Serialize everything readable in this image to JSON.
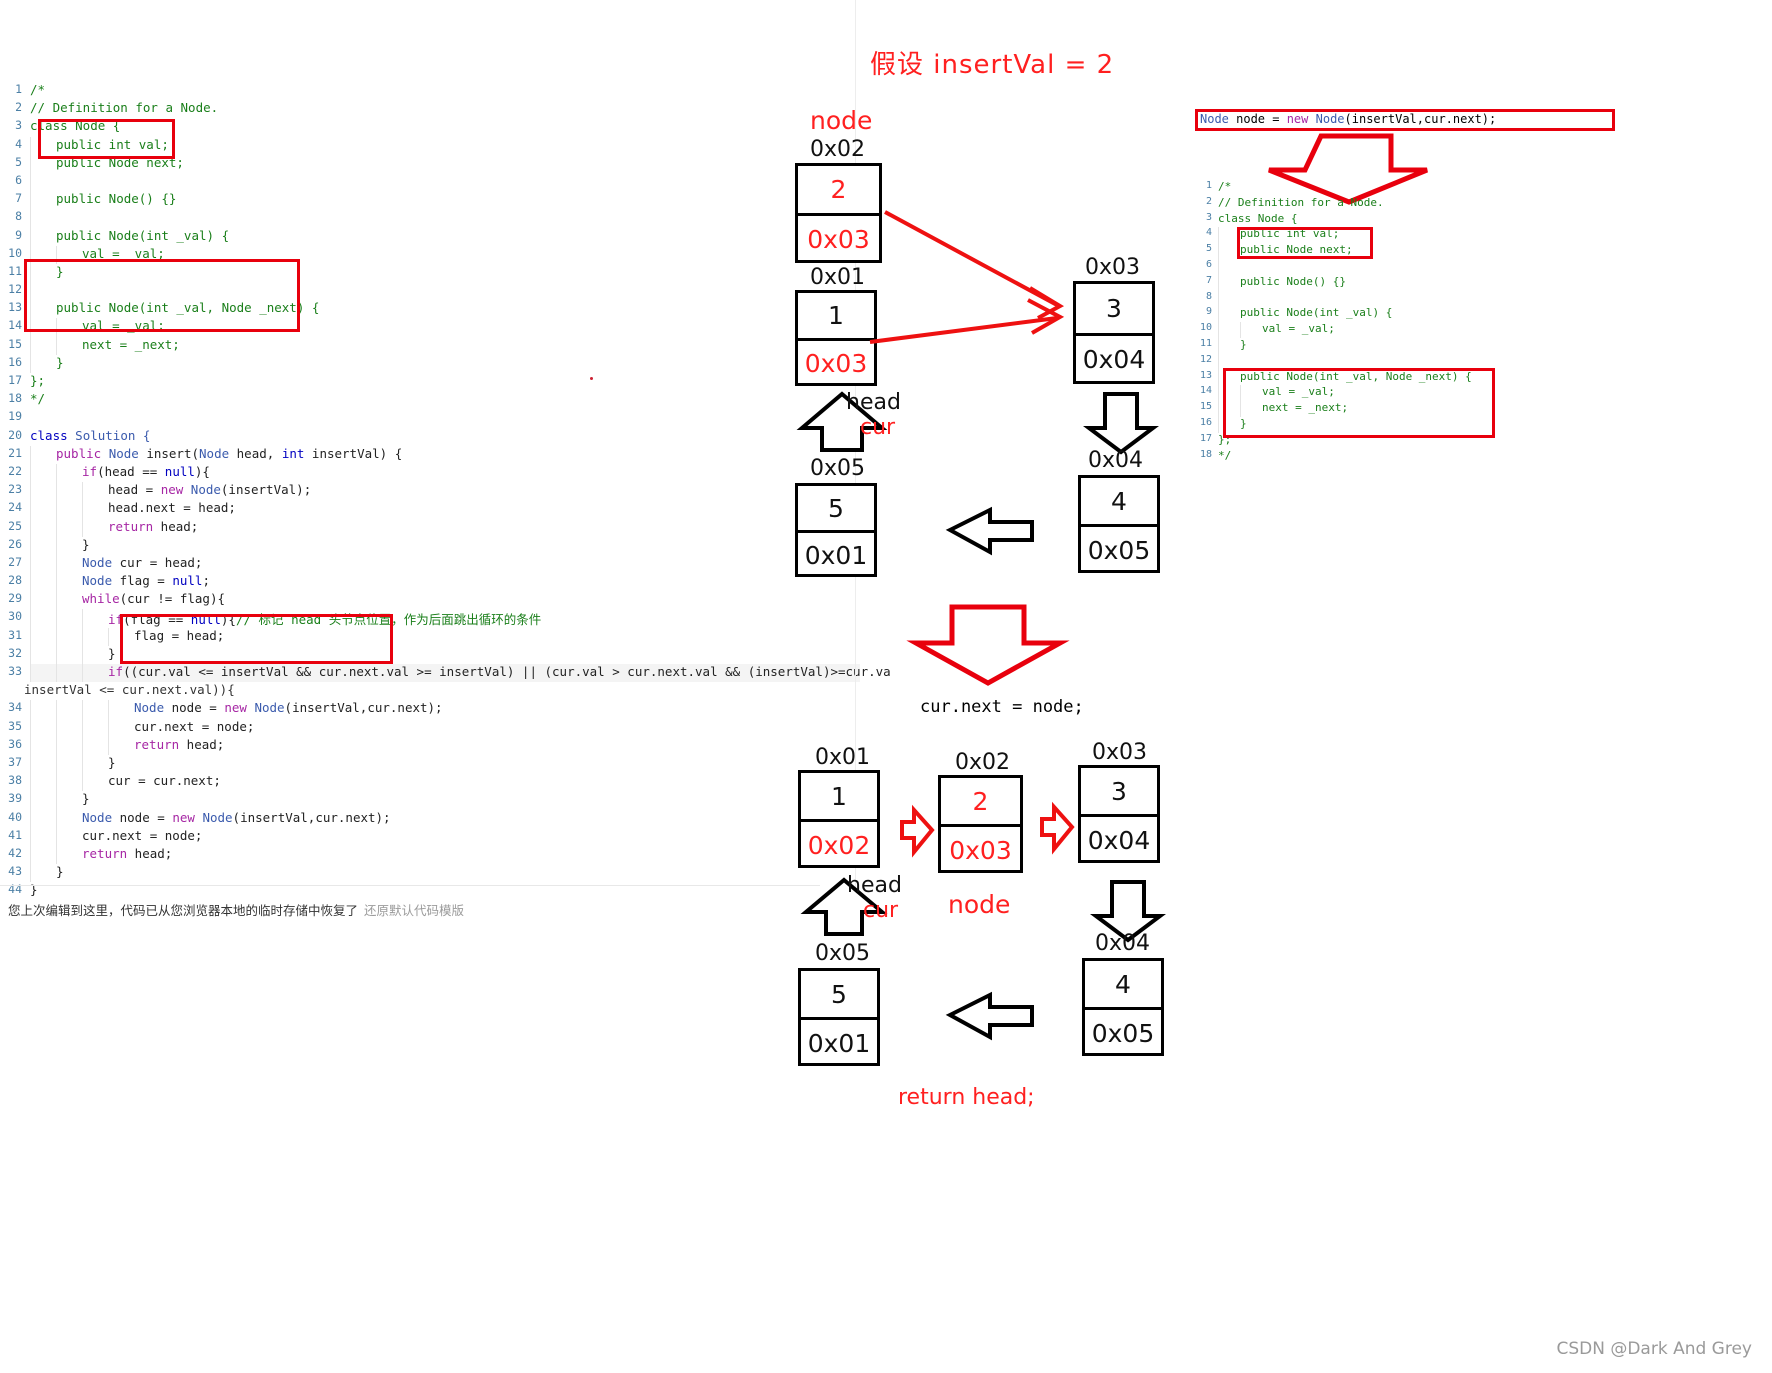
{
  "editor": {
    "lines": [
      {
        "n": "1",
        "indent": 0,
        "tokens": [
          {
            "t": "/*",
            "c": "cmt"
          }
        ]
      },
      {
        "n": "2",
        "indent": 0,
        "tokens": [
          {
            "t": "// Definition for a Node.",
            "c": "cmt"
          }
        ]
      },
      {
        "n": "3",
        "indent": 0,
        "tokens": [
          {
            "t": "class Node {",
            "c": "cmt"
          }
        ]
      },
      {
        "n": "4",
        "indent": 1,
        "tokens": [
          {
            "t": "public int val;",
            "c": "cmt"
          }
        ]
      },
      {
        "n": "5",
        "indent": 1,
        "tokens": [
          {
            "t": "public Node next;",
            "c": "cmt"
          }
        ]
      },
      {
        "n": "6",
        "indent": 1,
        "tokens": [
          {
            "t": "",
            "c": "cmt"
          }
        ]
      },
      {
        "n": "7",
        "indent": 1,
        "tokens": [
          {
            "t": "public Node() {}",
            "c": "cmt"
          }
        ]
      },
      {
        "n": "8",
        "indent": 1,
        "tokens": [
          {
            "t": "",
            "c": "cmt"
          }
        ]
      },
      {
        "n": "9",
        "indent": 1,
        "tokens": [
          {
            "t": "public Node(int _val) {",
            "c": "cmt"
          }
        ]
      },
      {
        "n": "10",
        "indent": 2,
        "tokens": [
          {
            "t": "val = _val;",
            "c": "cmt"
          }
        ]
      },
      {
        "n": "11",
        "indent": 1,
        "tokens": [
          {
            "t": "}",
            "c": "cmt"
          }
        ]
      },
      {
        "n": "12",
        "indent": 1,
        "tokens": [
          {
            "t": "",
            "c": "cmt"
          }
        ]
      },
      {
        "n": "13",
        "indent": 1,
        "tokens": [
          {
            "t": "public Node(int _val, Node _next) {",
            "c": "cmt"
          }
        ]
      },
      {
        "n": "14",
        "indent": 2,
        "tokens": [
          {
            "t": "val = _val;",
            "c": "cmt"
          }
        ]
      },
      {
        "n": "15",
        "indent": 2,
        "tokens": [
          {
            "t": "next = _next;",
            "c": "cmt"
          }
        ]
      },
      {
        "n": "16",
        "indent": 1,
        "tokens": [
          {
            "t": "}",
            "c": "cmt"
          }
        ]
      },
      {
        "n": "17",
        "indent": 0,
        "tokens": [
          {
            "t": "};",
            "c": "cmt"
          }
        ]
      },
      {
        "n": "18",
        "indent": 0,
        "tokens": [
          {
            "t": "*/",
            "c": "cmt"
          }
        ]
      },
      {
        "n": "19",
        "indent": 0,
        "tokens": [
          {
            "t": "",
            "c": "plain"
          }
        ]
      },
      {
        "n": "20",
        "indent": 0,
        "tokens": [
          {
            "t": "class",
            "c": "kw2"
          },
          {
            "t": " Solution {",
            "c": "typ"
          }
        ]
      },
      {
        "n": "21",
        "indent": 1,
        "tokens": [
          {
            "t": "public",
            "c": "kw"
          },
          {
            "t": " ",
            "c": "plain"
          },
          {
            "t": "Node",
            "c": "typ"
          },
          {
            "t": " insert(",
            "c": "plain"
          },
          {
            "t": "Node",
            "c": "typ"
          },
          {
            "t": " head, ",
            "c": "plain"
          },
          {
            "t": "int",
            "c": "kw2"
          },
          {
            "t": " insertVal) {",
            "c": "plain"
          }
        ]
      },
      {
        "n": "22",
        "indent": 2,
        "tokens": [
          {
            "t": "if",
            "c": "kw"
          },
          {
            "t": "(head == ",
            "c": "plain"
          },
          {
            "t": "null",
            "c": "kw2"
          },
          {
            "t": "){",
            "c": "plain"
          }
        ]
      },
      {
        "n": "23",
        "indent": 3,
        "tokens": [
          {
            "t": "head = ",
            "c": "plain"
          },
          {
            "t": "new",
            "c": "kw"
          },
          {
            "t": " ",
            "c": "plain"
          },
          {
            "t": "Node",
            "c": "typ"
          },
          {
            "t": "(insertVal);",
            "c": "plain"
          }
        ]
      },
      {
        "n": "24",
        "indent": 3,
        "tokens": [
          {
            "t": "head.next = head;",
            "c": "plain"
          }
        ]
      },
      {
        "n": "25",
        "indent": 3,
        "tokens": [
          {
            "t": "return",
            "c": "kw"
          },
          {
            "t": " head;",
            "c": "plain"
          }
        ]
      },
      {
        "n": "26",
        "indent": 2,
        "tokens": [
          {
            "t": "}",
            "c": "plain"
          }
        ]
      },
      {
        "n": "27",
        "indent": 2,
        "tokens": [
          {
            "t": "Node",
            "c": "typ"
          },
          {
            "t": " cur = head;",
            "c": "plain"
          }
        ]
      },
      {
        "n": "28",
        "indent": 2,
        "tokens": [
          {
            "t": "Node",
            "c": "typ"
          },
          {
            "t": " flag = ",
            "c": "plain"
          },
          {
            "t": "null",
            "c": "kw2"
          },
          {
            "t": ";",
            "c": "plain"
          }
        ]
      },
      {
        "n": "29",
        "indent": 2,
        "tokens": [
          {
            "t": "while",
            "c": "kw"
          },
          {
            "t": "(cur != flag){",
            "c": "plain"
          }
        ]
      },
      {
        "n": "30",
        "indent": 3,
        "tokens": [
          {
            "t": "if",
            "c": "kw"
          },
          {
            "t": "(flag == ",
            "c": "plain"
          },
          {
            "t": "null",
            "c": "kw2"
          },
          {
            "t": "){",
            "c": "plain"
          },
          {
            "t": "// 标记 head 头节点位置，作为后面跳出循环的条件",
            "c": "cmt"
          }
        ]
      },
      {
        "n": "31",
        "indent": 4,
        "tokens": [
          {
            "t": "flag = head;",
            "c": "plain"
          }
        ]
      },
      {
        "n": "32",
        "indent": 3,
        "tokens": [
          {
            "t": "}",
            "c": "plain"
          }
        ]
      },
      {
        "n": "33",
        "indent": 3,
        "hl": true,
        "tokens": [
          {
            "t": "if",
            "c": "kw"
          },
          {
            "t": "((cur.val <= insertVal && cur.next.val >= insertVal) || ",
            "c": "plain"
          },
          {
            "t": "(",
            "c": "plain"
          },
          {
            "t": "cur.val > cur.next.val && (insertVal)>=cur.va",
            "c": "plain"
          }
        ]
      },
      {
        "n": "34",
        "indent": 4,
        "tokens": [
          {
            "t": "Node",
            "c": "typ"
          },
          {
            "t": " node = ",
            "c": "plain"
          },
          {
            "t": "new",
            "c": "kw"
          },
          {
            "t": " ",
            "c": "plain"
          },
          {
            "t": "Node",
            "c": "typ"
          },
          {
            "t": "(insertVal,cur.next);",
            "c": "plain"
          }
        ]
      },
      {
        "n": "35",
        "indent": 4,
        "tokens": [
          {
            "t": "cur.next = node;",
            "c": "plain"
          }
        ]
      },
      {
        "n": "36",
        "indent": 4,
        "tokens": [
          {
            "t": "return",
            "c": "kw"
          },
          {
            "t": " head;",
            "c": "plain"
          }
        ]
      },
      {
        "n": "37",
        "indent": 3,
        "tokens": [
          {
            "t": "}",
            "c": "plain"
          }
        ]
      },
      {
        "n": "38",
        "indent": 3,
        "tokens": [
          {
            "t": "cur = cur.next;",
            "c": "plain"
          }
        ]
      },
      {
        "n": "39",
        "indent": 2,
        "tokens": [
          {
            "t": "}",
            "c": "plain"
          }
        ]
      },
      {
        "n": "40",
        "indent": 2,
        "tokens": [
          {
            "t": "Node",
            "c": "typ"
          },
          {
            "t": " node = ",
            "c": "plain"
          },
          {
            "t": "new",
            "c": "kw"
          },
          {
            "t": " ",
            "c": "plain"
          },
          {
            "t": "Node",
            "c": "typ"
          },
          {
            "t": "(insertVal,cur.next);",
            "c": "plain"
          }
        ]
      },
      {
        "n": "41",
        "indent": 2,
        "tokens": [
          {
            "t": "cur.next = node;",
            "c": "plain"
          }
        ]
      },
      {
        "n": "42",
        "indent": 2,
        "tokens": [
          {
            "t": "return",
            "c": "kw"
          },
          {
            "t": " head;",
            "c": "plain"
          }
        ]
      },
      {
        "n": "43",
        "indent": 1,
        "tokens": [
          {
            "t": "}",
            "c": "plain"
          }
        ]
      },
      {
        "n": "44",
        "indent": 0,
        "tokens": [
          {
            "t": "}",
            "c": "plain"
          }
        ]
      }
    ],
    "wrap_line_33": "insertVal <= cur.next.val)){",
    "footer": {
      "message": "您上次编辑到这里，代码已从您浏览器本地的临时存储中恢复了",
      "restore_link": "还原默认代码模版"
    }
  },
  "diagram": {
    "title": "假设  insertVal = 2",
    "stage1": {
      "node_tag": "node",
      "node_addr": "0x02",
      "node_val": "2",
      "node_next": "0x03",
      "n1_addr": "0x01",
      "n1_val": "1",
      "n1_next": "0x03",
      "n3_addr": "0x03",
      "n3_val": "3",
      "n3_next": "0x04",
      "head_label": "head",
      "cur_label": "cur",
      "n5_addr": "0x05",
      "n5_val": "5",
      "n5_next": "0x01",
      "n4_addr": "0x04",
      "n4_val": "4",
      "n4_next": "0x05"
    },
    "transition_code": "cur.next = node;",
    "stage2": {
      "n1_addr": "0x01",
      "n1_val": "1",
      "n1_next": "0x02",
      "n2_addr": "0x02",
      "n2_val": "2",
      "n2_next": "0x03",
      "n3_addr": "0x03",
      "n3_val": "3",
      "n3_next": "0x04",
      "head_label": "head",
      "cur_label": "cur",
      "node_label": "node",
      "n5_addr": "0x05",
      "n5_val": "5",
      "n5_next": "0x01",
      "n4_addr": "0x04",
      "n4_val": "4",
      "n4_next": "0x05",
      "return_label": "return head;"
    }
  },
  "rightcode": {
    "top_line": "Node node = new Node(insertVal,cur.next);",
    "lines": [
      {
        "n": "1",
        "indent": 0,
        "tokens": [
          {
            "t": "/*",
            "c": "cmt"
          }
        ]
      },
      {
        "n": "2",
        "indent": 0,
        "tokens": [
          {
            "t": "// Definition for a Node.",
            "c": "cmt"
          }
        ]
      },
      {
        "n": "3",
        "indent": 0,
        "tokens": [
          {
            "t": "class Node {",
            "c": "cmt"
          }
        ]
      },
      {
        "n": "4",
        "indent": 1,
        "tokens": [
          {
            "t": "public int val;",
            "c": "cmt"
          }
        ]
      },
      {
        "n": "5",
        "indent": 1,
        "tokens": [
          {
            "t": "public Node next;",
            "c": "cmt"
          }
        ]
      },
      {
        "n": "6",
        "indent": 1,
        "tokens": [
          {
            "t": "",
            "c": "cmt"
          }
        ]
      },
      {
        "n": "7",
        "indent": 1,
        "tokens": [
          {
            "t": "public Node() {}",
            "c": "cmt"
          }
        ]
      },
      {
        "n": "8",
        "indent": 1,
        "tokens": [
          {
            "t": "",
            "c": "cmt"
          }
        ]
      },
      {
        "n": "9",
        "indent": 1,
        "tokens": [
          {
            "t": "public Node(int _val) {",
            "c": "cmt"
          }
        ]
      },
      {
        "n": "10",
        "indent": 2,
        "tokens": [
          {
            "t": "val = _val;",
            "c": "cmt"
          }
        ]
      },
      {
        "n": "11",
        "indent": 1,
        "tokens": [
          {
            "t": "}",
            "c": "cmt"
          }
        ]
      },
      {
        "n": "12",
        "indent": 1,
        "tokens": [
          {
            "t": "",
            "c": "cmt"
          }
        ]
      },
      {
        "n": "13",
        "indent": 1,
        "tokens": [
          {
            "t": "public Node(int _val, Node _next) {",
            "c": "cmt"
          }
        ]
      },
      {
        "n": "14",
        "indent": 2,
        "tokens": [
          {
            "t": "val = _val;",
            "c": "cmt"
          }
        ]
      },
      {
        "n": "15",
        "indent": 2,
        "tokens": [
          {
            "t": "next = _next;",
            "c": "cmt"
          }
        ]
      },
      {
        "n": "16",
        "indent": 1,
        "tokens": [
          {
            "t": "}",
            "c": "cmt"
          }
        ]
      },
      {
        "n": "17",
        "indent": 0,
        "tokens": [
          {
            "t": "};",
            "c": "cmt"
          }
        ]
      },
      {
        "n": "18",
        "indent": 0,
        "tokens": [
          {
            "t": "*/",
            "c": "cmt"
          }
        ]
      }
    ]
  },
  "watermark": "CSDN @Dark And Grey",
  "colors": {
    "red": "#ff2020",
    "highlight_box": "#e8000d",
    "comment": "#1a7f1a",
    "keyword": "#a626a4",
    "type": "#3b5bad"
  }
}
